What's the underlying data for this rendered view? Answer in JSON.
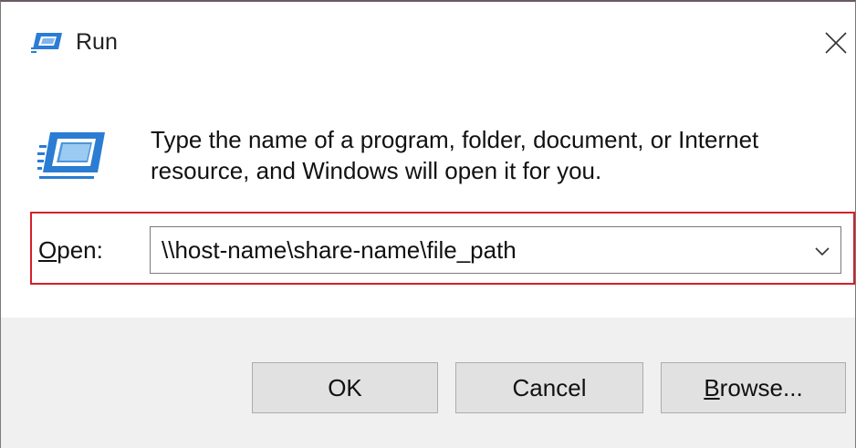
{
  "window": {
    "title": "Run",
    "close_icon": "close-icon",
    "app_icon": "run-app-icon"
  },
  "dialog": {
    "description_line1": "Type the name of a program, folder, document, or Internet",
    "description_line2": "resource, and Windows will open it for you.",
    "open_label_accel": "O",
    "open_label_rest": "pen:",
    "open_value": "\\\\host-name\\share-name\\file_path",
    "dropdown_icon": "chevron-down-icon"
  },
  "buttons": {
    "ok_label": "OK",
    "cancel_label": "Cancel",
    "browse_accel": "B",
    "browse_rest": "rowse..."
  },
  "colors": {
    "highlight_border": "#d4202a",
    "footer_bg": "#f0f0f0",
    "button_bg": "#e1e1e1",
    "icon_blue": "#2b7cd3"
  }
}
